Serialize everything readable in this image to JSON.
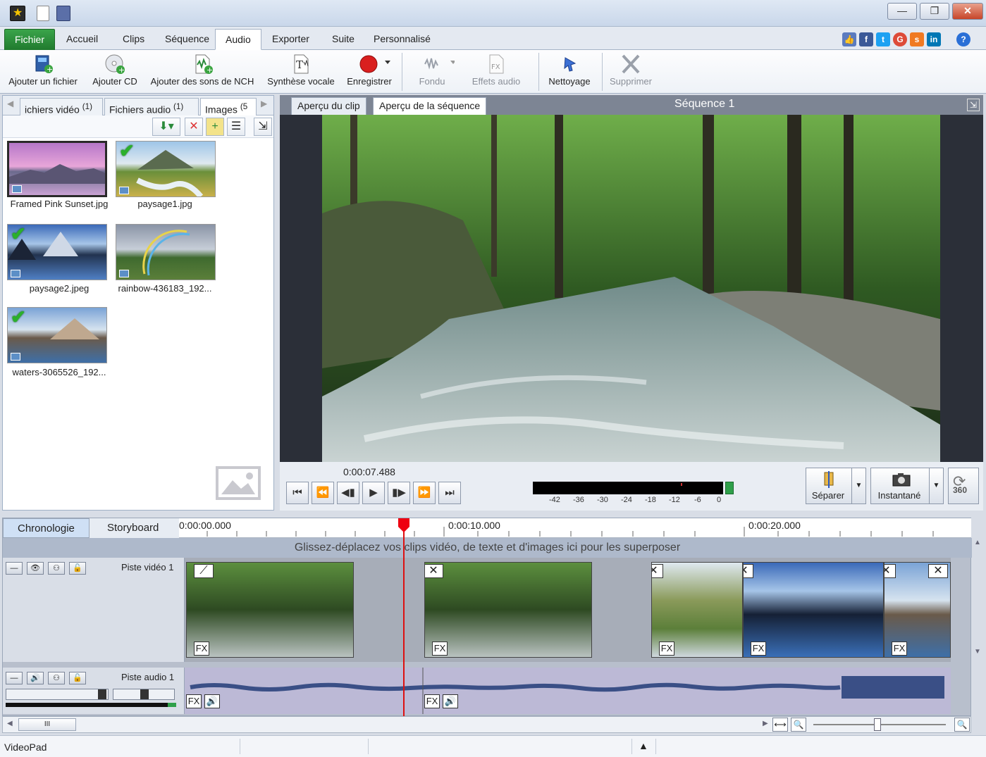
{
  "window": {
    "min_icon": "minimize-icon",
    "max_icon": "restore-icon",
    "close_icon": "close-icon",
    "min_glyph": "—",
    "max_glyph": "❐",
    "close_glyph": "✕"
  },
  "tabs": [
    "Fichier",
    "Accueil",
    "Clips",
    "Séquence",
    "Audio",
    "Exporter",
    "Suite",
    "Personnalisé"
  ],
  "ribbon": {
    "add_file": "Ajouter un fichier",
    "add_cd": "Ajouter CD",
    "add_nch": "Ajouter des sons de NCH",
    "tts": "Synthèse vocale",
    "record": "Enregistrer",
    "fade": "Fondu",
    "audio_effects": "Effets audio",
    "cleanup": "Nettoyage",
    "delete": "Supprimer"
  },
  "media_tabs": {
    "video": "ichiers vidéo",
    "video_count": "(1)",
    "audio": "Fichiers audio",
    "audio_count": "(1)",
    "images": "Images",
    "images_count": "(5"
  },
  "media_items": [
    {
      "name": "Framed Pink Sunset.jpg",
      "checked": false
    },
    {
      "name": "paysage1.jpg",
      "checked": true
    },
    {
      "name": "paysage2.jpeg",
      "checked": true
    },
    {
      "name": "rainbow-436183_192...",
      "checked": false
    },
    {
      "name": "waters-3065526_192...",
      "checked": true
    }
  ],
  "preview": {
    "clip_tab": "Aperçu du clip",
    "seq_tab": "Aperçu de la séquence",
    "title": "Séquence 1",
    "timecode": "0:00:07.488"
  },
  "meter_scale": [
    "-42",
    "-36",
    "-30",
    "-24",
    "-18",
    "-12",
    "-6",
    "0"
  ],
  "buttons": {
    "split": "Séparer",
    "snapshot": "Instantané",
    "three60": "360"
  },
  "timeline": {
    "tab_chrono": "Chronologie",
    "tab_story": "Storyboard",
    "ruler": [
      "0:00:00.000",
      "0:00:10.000",
      "0:00:20.000"
    ],
    "overlay_hint": "Glissez-déplacez vos clips vidéo, de texte et d'images ici pour les superposer",
    "video_track": "Piste vidéo 1",
    "audio_track": "Piste audio 1",
    "fx": "FX"
  },
  "hscroll_grip": "III",
  "status": {
    "app": "VideoPad"
  }
}
